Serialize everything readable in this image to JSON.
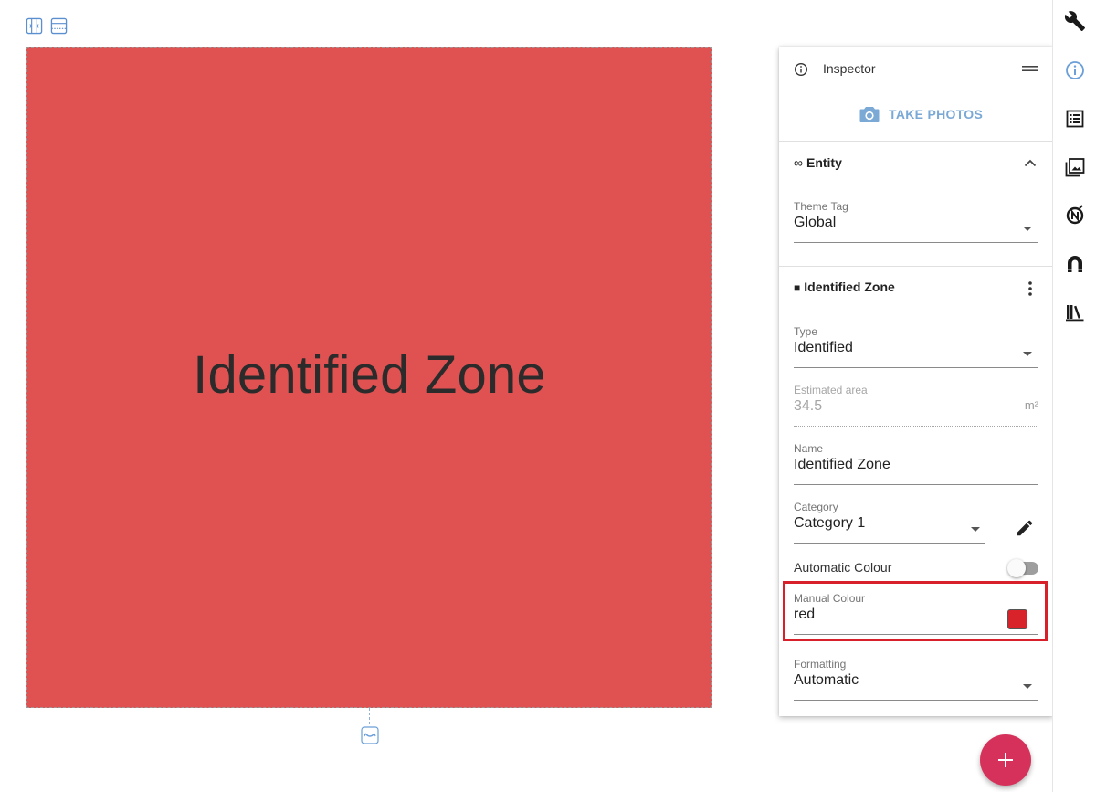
{
  "canvas": {
    "zone_label": "Identified Zone",
    "zone_color": "#e05252"
  },
  "toolbar": {
    "icons": [
      "vertical-split-icon",
      "horizontal-split-icon"
    ]
  },
  "inspector": {
    "title": "Inspector",
    "take_photos_label": "TAKE PHOTOS",
    "entity_section": {
      "lead_symbol": "∞",
      "title": "Entity",
      "theme_tag": {
        "label": "Theme Tag",
        "value": "Global"
      }
    },
    "zone_section": {
      "lead_symbol": "■",
      "title": "Identified Zone",
      "type": {
        "label": "Type",
        "value": "Identified"
      },
      "estimated_area": {
        "label": "Estimated area",
        "value": "34.5",
        "unit": "m²"
      },
      "name": {
        "label": "Name",
        "value": "Identified Zone"
      },
      "category": {
        "label": "Category",
        "value": "Category 1"
      },
      "automatic_colour": {
        "label": "Automatic Colour",
        "enabled": false
      },
      "manual_colour": {
        "label": "Manual Colour",
        "value": "red",
        "swatch_color": "#d8232a"
      },
      "formatting": {
        "label": "Formatting",
        "value": "Automatic"
      }
    }
  },
  "rail": {
    "icons": [
      "wrench-icon",
      "info-icon",
      "list-icon",
      "image-gallery-icon",
      "n-circle-icon",
      "magnet-icon",
      "library-icon"
    ],
    "accent": "#6a9fd8"
  },
  "fab": {
    "color": "#d6315a"
  }
}
